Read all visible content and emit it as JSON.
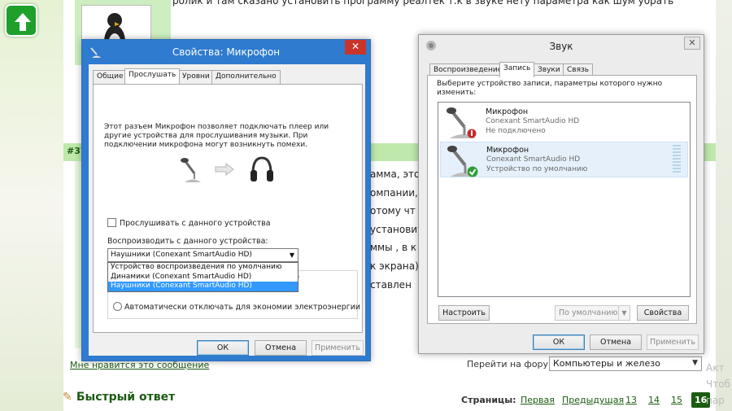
{
  "forum": {
    "post_top_text": "ролик и там сказано установить программу реалтек т.к в звуке нету параметра как шум убрать",
    "post_number": "#37",
    "post_fragments": [
      "амма, это",
      "омпании,",
      "отому чт",
      "установит",
      "ммы , в к",
      "к экрана)",
      "ставлен"
    ],
    "post_link": "Мне нравится это сообщение",
    "goto_forum_label": "Перейти на форум:",
    "goto_forum_value": "Компьютеры и железо",
    "quick_reply": "Быстрый ответ",
    "pages_label": "Страницы:",
    "pages": [
      "Первая",
      "Предыдущая",
      "13",
      "14",
      "15",
      "16"
    ],
    "current_page": "16",
    "watermark": [
      "Акт",
      "Чтоб",
      "пар"
    ]
  },
  "mic_dialog": {
    "title": "Свойства: Микрофон",
    "close": "✕",
    "tabs": [
      "Общие",
      "Прослушать",
      "Уровни",
      "Дополнительно"
    ],
    "selected_tab": "Прослушать",
    "description": "Этот разъем Микрофон позволяет подключать плеер или другие устройства для прослушивания музыки. При подключении микрофона могут возникнуть помехи.",
    "listen_checkbox": "Прослушивать с данного устройства",
    "playback_label": "Воспроизводить с данного устройства:",
    "playback_selected": "Наушники (Conexant SmartAudio HD)",
    "playback_options": [
      "Устройство воспроизведения по умолчанию",
      "Динамики (Conexant SmartAudio HD)",
      "Наушники (Conexant SmartAudio HD)"
    ],
    "power_text_partial": "от",
    "power_option_2": "Автоматически отключать для экономии электроэнергии",
    "buttons": {
      "ok": "ОК",
      "cancel": "Отмена",
      "apply": "Применить"
    }
  },
  "sound_dialog": {
    "title": "Звук",
    "close": "✕",
    "tabs": [
      "Воспроизведение",
      "Запись",
      "Звуки",
      "Связь"
    ],
    "selected_tab": "Запись",
    "description": "Выберите устройство записи, параметры которого нужно изменить:",
    "devices": [
      {
        "name": "Микрофон",
        "driver": "Conexant SmartAudio HD",
        "status": "Не подключено"
      },
      {
        "name": "Микрофон",
        "driver": "Conexant SmartAudio HD",
        "status": "Устройство по умолчанию"
      }
    ],
    "buttons": {
      "configure": "Настроить",
      "default": "По умолчанию",
      "properties": "Свойства",
      "ok": "ОК",
      "cancel": "Отмена",
      "apply": "Применить"
    }
  },
  "colors": {
    "forum_green": "#1c5c12",
    "titlebar_blue": "#2e7bcf",
    "close_red": "#c9352b",
    "highlight": "#3399ff"
  }
}
